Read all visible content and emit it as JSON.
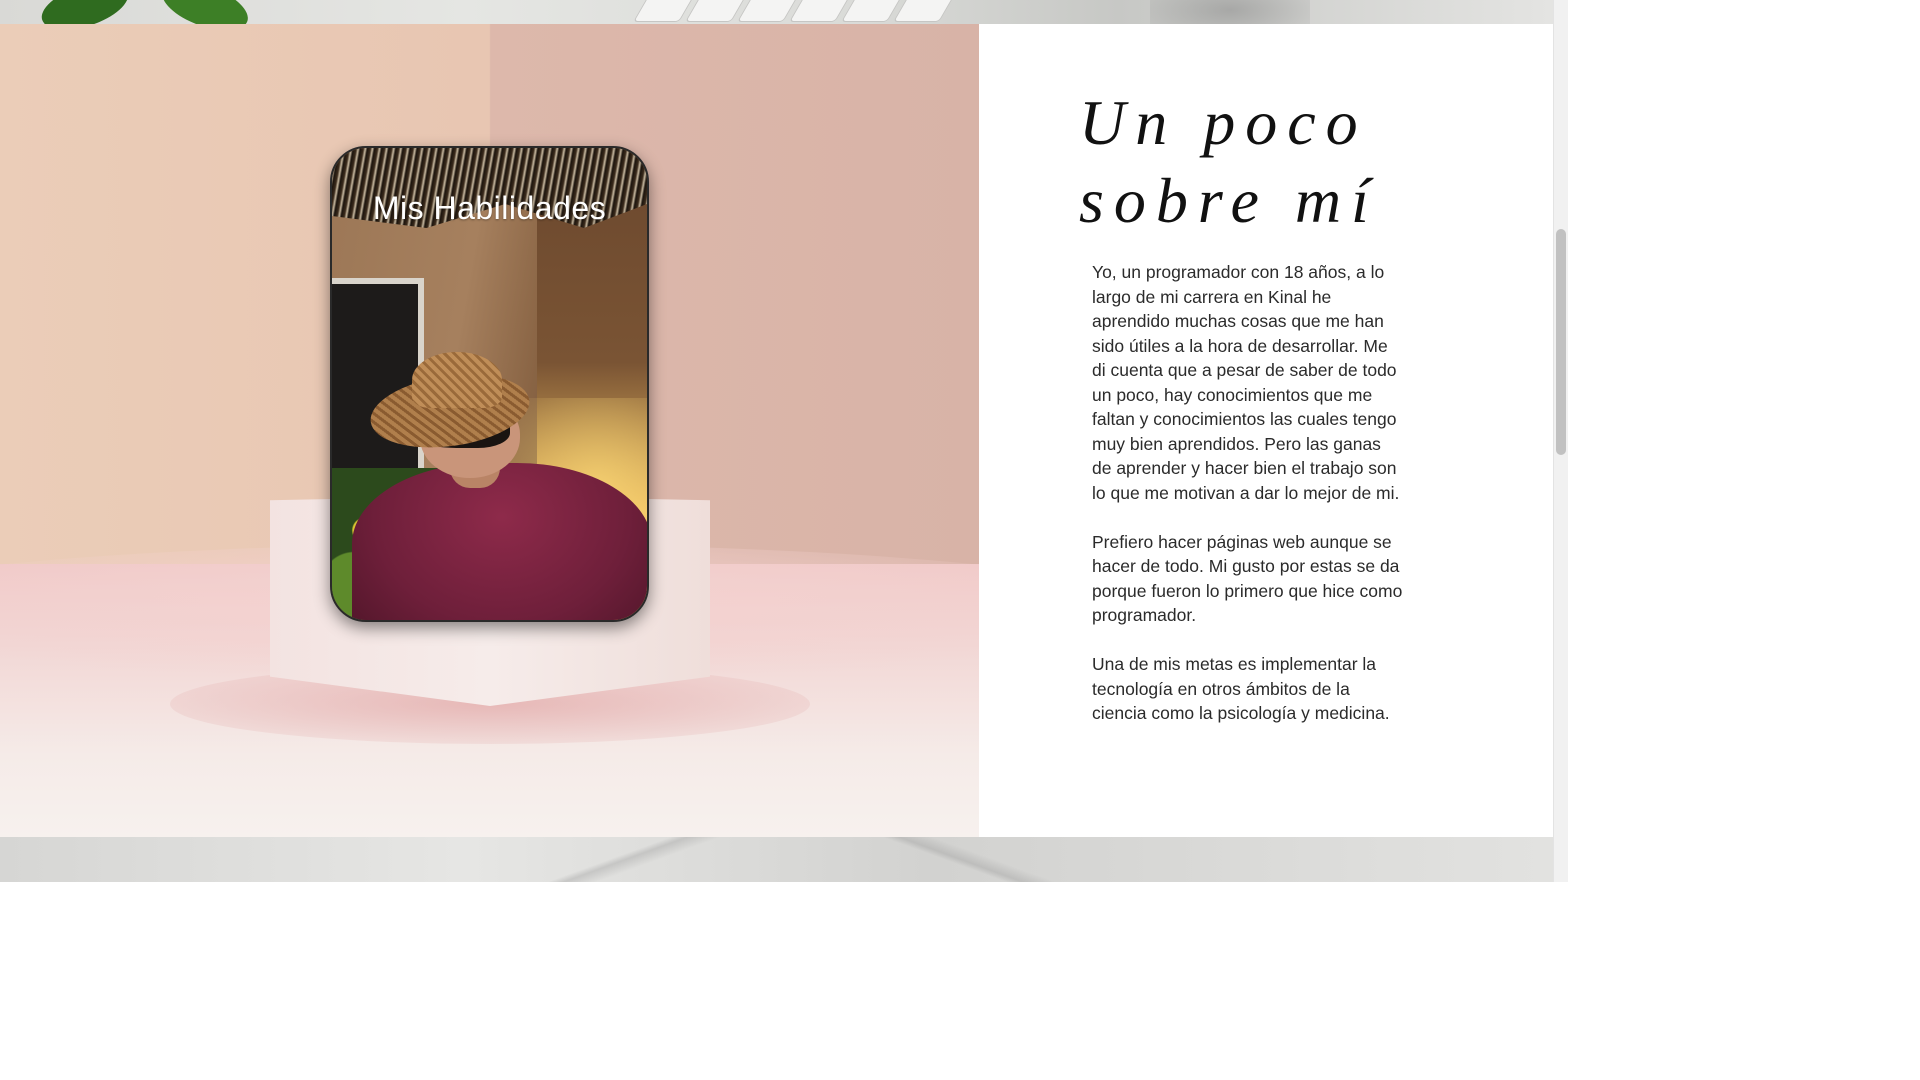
{
  "photo_card": {
    "title": "Mis Habilidades"
  },
  "about": {
    "heading": "Un poco sobre mí",
    "paragraphs": [
      "Yo, un programador con 18 años, a lo largo de mi carrera en Kinal he aprendido muchas cosas que me han sido útiles a la hora de desarrollar. Me di cuenta que a pesar de saber de todo un poco, hay conocimientos que me faltan y conocimientos las cuales tengo muy bien aprendidos. Pero las ganas de aprender y hacer bien el trabajo son lo que me motivan a dar lo mejor de mi.",
      "Prefiero hacer páginas web aunque se hacer de todo. Mi gusto por estas se da porque fueron lo primero que hice como programador.",
      "Una de mis metas es implementar la tecnología en otros ámbitos de la ciencia como la psicología y medicina."
    ]
  }
}
